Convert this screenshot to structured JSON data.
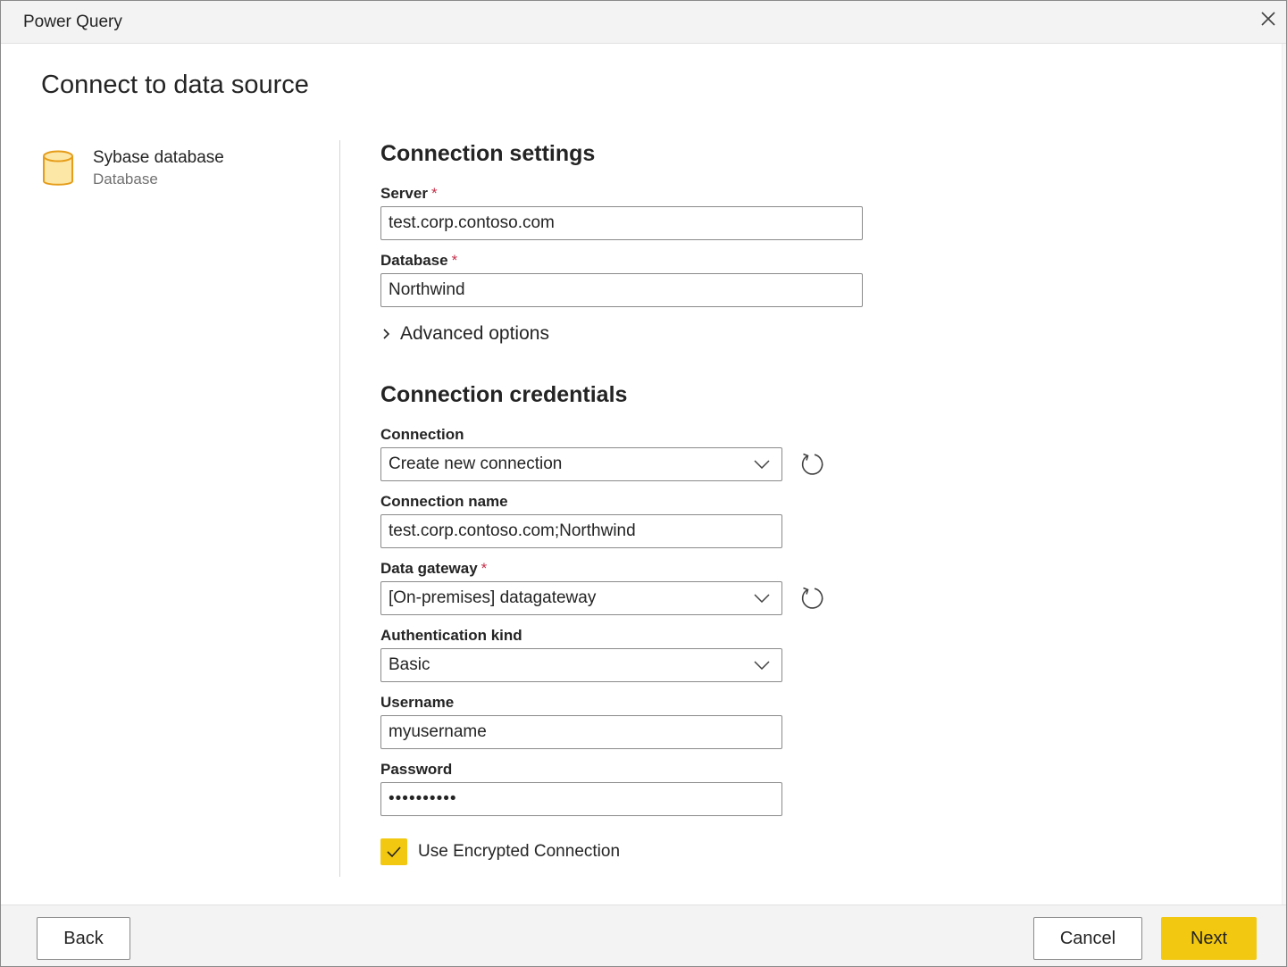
{
  "window": {
    "title": "Power Query",
    "close_icon": "close-icon"
  },
  "page": {
    "title": "Connect to data source"
  },
  "source": {
    "name": "Sybase database",
    "type": "Database",
    "icon": "database-cylinder-icon",
    "icon_color": "#f2c811"
  },
  "settings": {
    "heading": "Connection settings",
    "server": {
      "label": "Server",
      "required": "*",
      "value": "test.corp.contoso.com"
    },
    "database": {
      "label": "Database",
      "required": "*",
      "value": "Northwind"
    },
    "advanced_label": "Advanced options"
  },
  "credentials": {
    "heading": "Connection credentials",
    "connection": {
      "label": "Connection",
      "value": "Create new connection"
    },
    "connection_name": {
      "label": "Connection name",
      "value": "test.corp.contoso.com;Northwind"
    },
    "gateway": {
      "label": "Data gateway",
      "required": "*",
      "value": "[On-premises] datagateway"
    },
    "auth_kind": {
      "label": "Authentication kind",
      "value": "Basic"
    },
    "username": {
      "label": "Username",
      "value": "myusername"
    },
    "password": {
      "label": "Password",
      "value": "••••••••••"
    },
    "encrypted": {
      "label": "Use Encrypted Connection",
      "checked": true
    }
  },
  "footer": {
    "back": "Back",
    "cancel": "Cancel",
    "next": "Next"
  },
  "colors": {
    "accent": "#f2c811",
    "required": "#c4314b",
    "border": "#8a8a8a"
  }
}
